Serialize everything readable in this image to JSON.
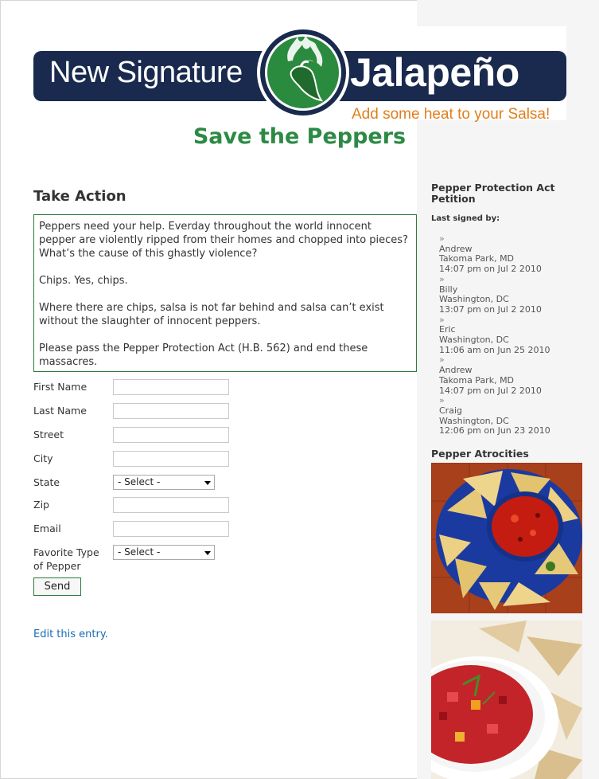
{
  "header": {
    "brand_left": "New Signature",
    "brand_right": "Jalapeño",
    "tagline": "Add some heat to your Salsa!",
    "logo_icon": "jalapeno-flame-logo-icon"
  },
  "site_title": "Save the Peppers",
  "main": {
    "heading": "Take Action",
    "message": [
      "Peppers need your help. Everday throughout the world innocent pepper are violently ripped from their homes and chopped into pieces? What’s the cause of this ghastly violence?",
      "Chips. Yes, chips.",
      "Where there are chips, salsa is not far behind and salsa can’t exist without the slaughter of innocent peppers.",
      "Please pass the Pepper Protection Act (H.B. 562) and end these massacres."
    ],
    "form": {
      "first_name_label": "First Name",
      "last_name_label": "Last Name",
      "street_label": "Street",
      "city_label": "City",
      "state_label": "State",
      "state_value": "- Select -",
      "zip_label": "Zip",
      "email_label": "Email",
      "pepper_label": "Favorite Type of Pepper",
      "pepper_value": "- Select -",
      "send_label": "Send"
    },
    "edit_link": "Edit this entry."
  },
  "sidebar": {
    "petition_title": "Pepper Protection Act Petition",
    "last_signed_label": "Last signed by:",
    "signers": [
      {
        "bullet": "»",
        "name": "Andrew",
        "location": "Takoma Park, MD",
        "time": "14:07 pm on Jul 2 2010"
      },
      {
        "bullet": "»",
        "name": "Billy",
        "location": "Washington, DC",
        "time": "13:07 pm on Jul 2 2010"
      },
      {
        "bullet": "»",
        "name": "Eric",
        "location": "Washington, DC",
        "time": "11:06 am on Jun 25 2010"
      },
      {
        "bullet": "»",
        "name": "Andrew",
        "location": "Takoma Park, MD",
        "time": "14:07 pm on Jul 2 2010"
      },
      {
        "bullet": "»",
        "name": "Craig",
        "location": "Washington, DC",
        "time": "12:06 pm on Jun 23 2010"
      }
    ],
    "atrocities_title": "Pepper Atrocities"
  },
  "colors": {
    "banner_navy": "#192a4e",
    "title_green": "#2c8a45",
    "tagline_orange": "#e07f1d",
    "link_blue": "#1a6bb5",
    "sidebar_gray": "#f5f5f5"
  }
}
